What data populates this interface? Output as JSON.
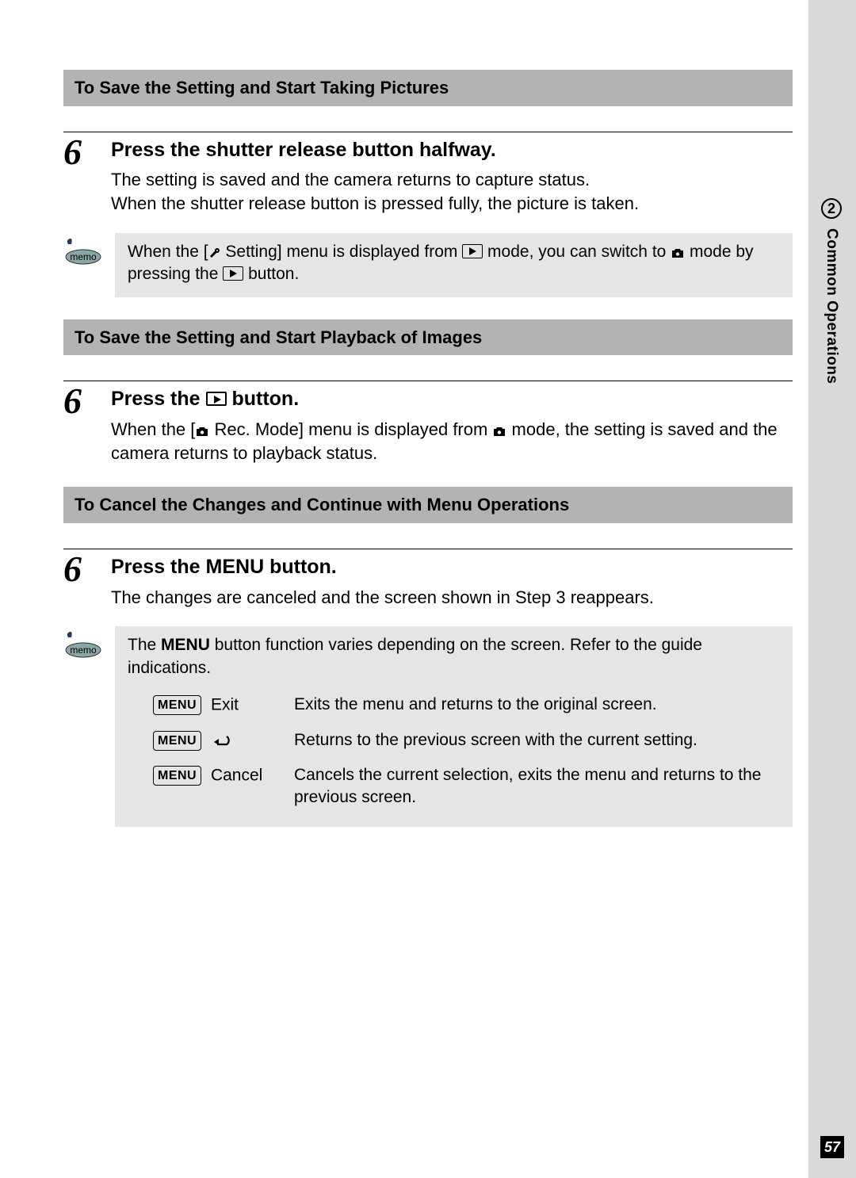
{
  "sidebar": {
    "chapter_num": "2",
    "chapter_title": "Common Operations"
  },
  "page_number": "57",
  "sections": {
    "s1": {
      "bar": "To Save the Setting and Start Taking Pictures",
      "step_num": "6",
      "step_title": "Press the shutter release button halfway.",
      "desc_line1": "The setting is saved and the camera returns to capture status.",
      "desc_line2": "When the shutter release button is pressed fully, the picture is taken.",
      "memo_pre": "When the [",
      "memo_mid1": " Setting] menu is displayed from ",
      "memo_mid2": " mode, you can switch to ",
      "memo_mid3": " mode by pressing the ",
      "memo_post": " button."
    },
    "s2": {
      "bar": "To Save the Setting and Start Playback of Images",
      "step_num": "6",
      "step_title_pre": "Press the ",
      "step_title_post": " button.",
      "desc_pre": "When the [",
      "desc_mid1": " Rec. Mode] menu is displayed from ",
      "desc_mid2": " mode, the setting is saved and the camera returns to playback status."
    },
    "s3": {
      "bar": "To Cancel the Changes and Continue with Menu Operations",
      "step_num": "6",
      "step_title_pre": "Press the ",
      "step_title_menu": "MENU",
      "step_title_post": " button.",
      "desc": "The changes are canceled and the screen shown in Step 3 reappears.",
      "memo_intro_pre": "The ",
      "memo_intro_bold": "MENU",
      "memo_intro_post": " button function varies depending on the screen. Refer to the guide indications.",
      "menu_btn_label": "MENU",
      "rows": {
        "r1": {
          "label": "Exit",
          "desc": "Exits the menu and returns to the original screen."
        },
        "r2": {
          "desc": "Returns to the previous screen with the current setting."
        },
        "r3": {
          "label": "Cancel",
          "desc": "Cancels the current selection, exits the menu and returns to the previous screen."
        }
      }
    }
  }
}
